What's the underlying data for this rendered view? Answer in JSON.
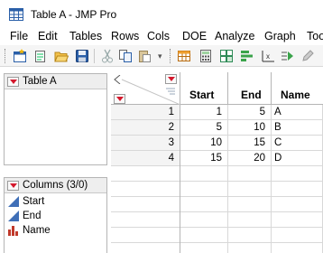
{
  "window": {
    "title": "Table A - JMP Pro"
  },
  "menu": [
    "File",
    "Edit",
    "Tables",
    "Rows",
    "Cols",
    "DOE",
    "Analyze",
    "Graph",
    "Too"
  ],
  "left_panel": {
    "title": "Table A"
  },
  "columns_panel": {
    "title": "Columns (3/0)",
    "items": [
      {
        "label": "Start",
        "type_icon": "continuous-icon"
      },
      {
        "label": "End",
        "type_icon": "continuous-icon"
      },
      {
        "label": "Name",
        "type_icon": "nominal-icon"
      }
    ]
  },
  "table": {
    "headers": [
      "Start",
      "End",
      "Name"
    ],
    "rows": [
      {
        "n": "1",
        "start": "1",
        "end": "5",
        "name": "A"
      },
      {
        "n": "2",
        "start": "5",
        "end": "10",
        "name": "B"
      },
      {
        "n": "3",
        "start": "10",
        "end": "15",
        "name": "C"
      },
      {
        "n": "4",
        "start": "15",
        "end": "20",
        "name": "D"
      }
    ]
  },
  "colors": {
    "accent_red": "#d4182c",
    "continuous_blue": "#3f6fb7",
    "nominal_red": "#c0392b"
  }
}
